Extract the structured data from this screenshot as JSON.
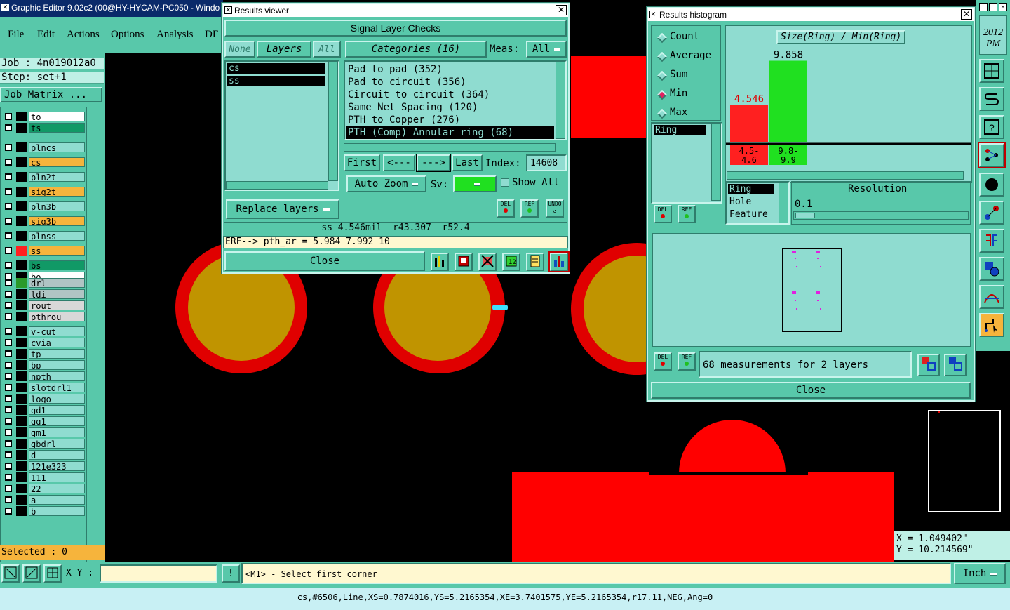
{
  "main_window": {
    "title": "Graphic Editor 9.02c2 (00@HY-HYCAM-PC050 - Windo",
    "menu": [
      "File",
      "Edit",
      "Actions",
      "Options",
      "Analysis",
      "DF"
    ]
  },
  "left_panel": {
    "job": "Job : 4n019012a0",
    "step": "Step: set+1",
    "job_matrix_label": "Job Matrix ...",
    "selected": "Selected : 0",
    "layers": [
      {
        "name": "to",
        "color": "#ffffff",
        "swatch": "#000000"
      },
      {
        "name": "ts",
        "color": "#119966",
        "swatch": "#000000"
      },
      {
        "name": "plncs",
        "color": "#8fdcd0",
        "swatch": "#000000"
      },
      {
        "name": "cs",
        "color": "#f6b43c",
        "swatch": "#000000"
      },
      {
        "name": "pln2t",
        "color": "#8fdcd0",
        "swatch": "#000000"
      },
      {
        "name": "sig2t",
        "color": "#f6b43c",
        "swatch": "#000000"
      },
      {
        "name": "pln3b",
        "color": "#8fdcd0",
        "swatch": "#000000"
      },
      {
        "name": "sig3b",
        "color": "#f6b43c",
        "swatch": "#000000"
      },
      {
        "name": "plnss",
        "color": "#8fdcd0",
        "swatch": "#000000"
      },
      {
        "name": "ss",
        "color": "#f6b43c",
        "swatch": "#ff2020"
      },
      {
        "name": "bs",
        "color": "#119966",
        "swatch": "#000000"
      },
      {
        "name": "bo",
        "color": "#ffffff",
        "swatch": "#000000"
      },
      {
        "name": "drl",
        "color": "#b0c4c4",
        "swatch": "#2a9a2a"
      },
      {
        "name": "ldi",
        "color": "#b0c4c4",
        "swatch": "#000000"
      },
      {
        "name": "rout",
        "color": "#d8d8d8",
        "swatch": "#000000"
      },
      {
        "name": "pthrou",
        "color": "#d8d8d8",
        "swatch": "#000000"
      },
      {
        "name": "v-cut",
        "color": "#8fdcd0",
        "swatch": "#000000"
      },
      {
        "name": "cvia",
        "color": "#8fdcd0",
        "swatch": "#000000"
      },
      {
        "name": "tp",
        "color": "#8fdcd0",
        "swatch": "#000000"
      },
      {
        "name": "bp",
        "color": "#8fdcd0",
        "swatch": "#000000"
      },
      {
        "name": "npth",
        "color": "#8fdcd0",
        "swatch": "#000000"
      },
      {
        "name": "slotdrl1",
        "color": "#8fdcd0",
        "swatch": "#000000"
      },
      {
        "name": "logo",
        "color": "#8fdcd0",
        "swatch": "#000000"
      },
      {
        "name": "gd1",
        "color": "#8fdcd0",
        "swatch": "#000000"
      },
      {
        "name": "gg1",
        "color": "#8fdcd0",
        "swatch": "#000000"
      },
      {
        "name": "gm1",
        "color": "#8fdcd0",
        "swatch": "#000000"
      },
      {
        "name": "gbdrl",
        "color": "#8fdcd0",
        "swatch": "#000000"
      },
      {
        "name": "d",
        "color": "#8fdcd0",
        "swatch": "#000000"
      },
      {
        "name": "121e323",
        "color": "#8fdcd0",
        "swatch": "#000000"
      },
      {
        "name": "111",
        "color": "#8fdcd0",
        "swatch": "#000000"
      },
      {
        "name": "22",
        "color": "#8fdcd0",
        "swatch": "#000000"
      },
      {
        "name": "a",
        "color": "#8fdcd0",
        "swatch": "#000000"
      },
      {
        "name": "b",
        "color": "#8fdcd0",
        "swatch": "#000000"
      }
    ]
  },
  "results_viewer": {
    "title": "Results viewer",
    "header": "Signal Layer Checks",
    "none_label": "None",
    "layers_label": "Layers",
    "all_label": "All",
    "categories_label": "Categories (16)",
    "meas_label": "Meas:",
    "meas_value": "All",
    "layer_items": [
      "cs",
      "ss"
    ],
    "categories": [
      "Pad to pad (352)",
      "Pad to circuit (356)",
      "Circuit to circuit (364)",
      "Same Net Spacing (120)",
      "PTH to Copper (276)",
      "PTH (Comp) Annular ring (68)"
    ],
    "first_label": "First",
    "prev_label": "<---",
    "next_label": "--->",
    "last_label": "Last",
    "index_label": "Index:",
    "index_value": "14608",
    "auto_zoom_label": "Auto Zoom",
    "sv_label": "Sv:",
    "show_all_label": "Show All",
    "replace_layers_label": "Replace layers",
    "del_label": "DEL",
    "ref_label": "REF",
    "undo_label": "UNDO",
    "measurement": "ss 4.546mil  r43.307  r52.4",
    "erf_line": "ERF--> pth_ar = 5.984 7.992 10",
    "close_label": "Close"
  },
  "results_histogram": {
    "title": "Results histogram",
    "stat_options": [
      "Count",
      "Average",
      "Sum",
      "Min",
      "Max"
    ],
    "selected_stat": "Min",
    "chart_title": "Size(Ring) / Min(Ring)",
    "list_items": [
      "Ring"
    ],
    "feature_items": [
      "Ring",
      "Hole",
      "Feature"
    ],
    "resolution_label": "Resolution",
    "resolution_value": "0.1",
    "del_label": "DEL",
    "ref_label": "REF",
    "status": "68 measurements for 2 layers",
    "close_label": "Close",
    "chart_data": {
      "type": "bar",
      "title": "Size(Ring) / Min(Ring)",
      "categories": [
        "4.5-4.6",
        "9.8-9.9"
      ],
      "values": [
        4.546,
        9.858
      ],
      "value_labels": [
        "4.546",
        "9.858"
      ],
      "colors": [
        "#ff2020",
        "#20e020"
      ],
      "ylim": [
        0,
        11
      ]
    }
  },
  "right_panel": {
    "time": "2012\nPM",
    "x_readout": "X = 1.049402\"",
    "y_readout": "Y = 10.214569\""
  },
  "bottom": {
    "xy_label": "X Y :",
    "xy_value": "",
    "prompt": "<M1> - Select first corner",
    "units": "Inch",
    "status_line": "cs,#6506,Line,XS=0.7874016,YS=5.2165354,XE=3.7401575,YE=5.2165354,r17.11,NEG,Ang=0"
  }
}
